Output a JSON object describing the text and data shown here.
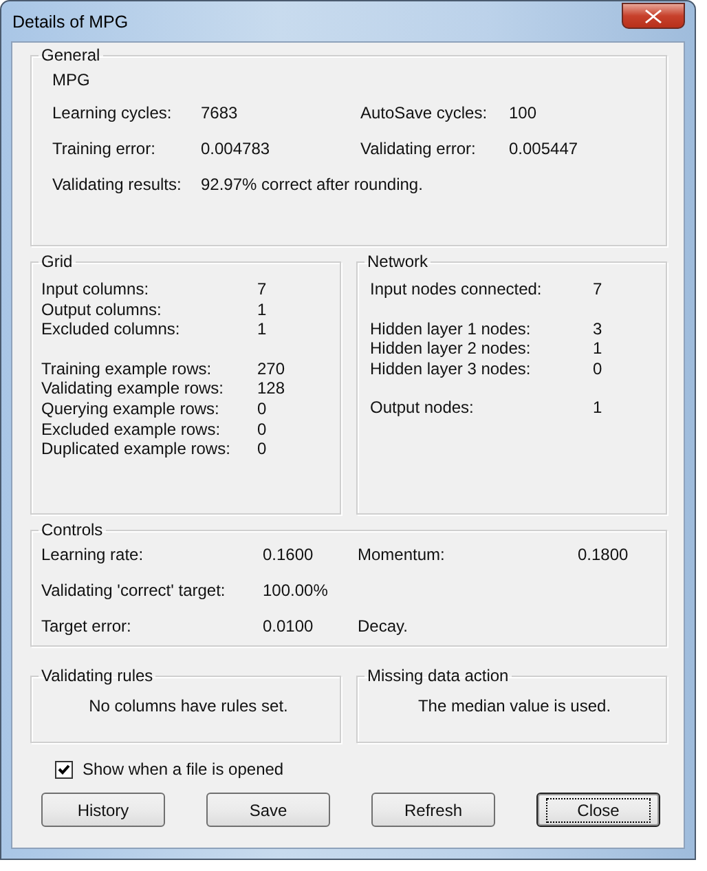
{
  "window": {
    "title": "Details of MPG"
  },
  "general": {
    "title": "General",
    "name": "MPG",
    "rows": [
      {
        "label": "Learning cycles:",
        "value": "7683",
        "label_2": "AutoSave cycles:",
        "value_2": "100"
      },
      {
        "label": "Training error:",
        "value": "0.004783",
        "label_2": "Validating error:",
        "value_2": "0.005447"
      },
      {
        "label": "Validating results:",
        "value": "92.97% correct after rounding."
      }
    ]
  },
  "grid": {
    "title": "Grid",
    "sections": [
      [
        {
          "label": "Input columns:",
          "value": "7"
        },
        {
          "label": "Output columns:",
          "value": "1"
        },
        {
          "label": "Excluded columns:",
          "value": "1"
        }
      ],
      [
        {
          "label": "Training example rows:",
          "value": "270"
        },
        {
          "label": "Validating example rows:",
          "value": "128"
        },
        {
          "label": "Querying example rows:",
          "value": "0"
        },
        {
          "label": "Excluded example rows:",
          "value": "0"
        },
        {
          "label": "Duplicated example rows:",
          "value": "0"
        }
      ]
    ]
  },
  "network": {
    "title": "Network",
    "sections": [
      [
        {
          "label": "Input nodes connected:",
          "value": "7"
        }
      ],
      [
        {
          "label": "Hidden layer 1 nodes:",
          "value": "3"
        },
        {
          "label": "Hidden layer 2 nodes:",
          "value": "1"
        },
        {
          "label": "Hidden layer 3 nodes:",
          "value": "0"
        }
      ],
      [
        {
          "label": "Output nodes:",
          "value": "1"
        }
      ]
    ]
  },
  "controls": {
    "title": "Controls",
    "rows": [
      {
        "label": "Learning rate:",
        "value": "0.1600",
        "label_2": "Momentum:",
        "value_2": "0.1800"
      },
      {
        "label": "Validating 'correct' target:",
        "value": "100.00%"
      },
      {
        "label": "Target error:",
        "value": "0.0100",
        "label_2": "Decay."
      }
    ]
  },
  "validating_rules": {
    "title": "Validating rules",
    "text": "No columns have rules set."
  },
  "missing_data_action": {
    "title": "Missing data action",
    "text": "The median value is used."
  },
  "show_when_opened": {
    "label": "Show when a file is opened",
    "checked": true
  },
  "buttons": [
    {
      "label": "History",
      "default": false
    },
    {
      "label": "Save",
      "default": false
    },
    {
      "label": "Refresh",
      "default": false
    },
    {
      "label": "Close",
      "default": true
    }
  ]
}
